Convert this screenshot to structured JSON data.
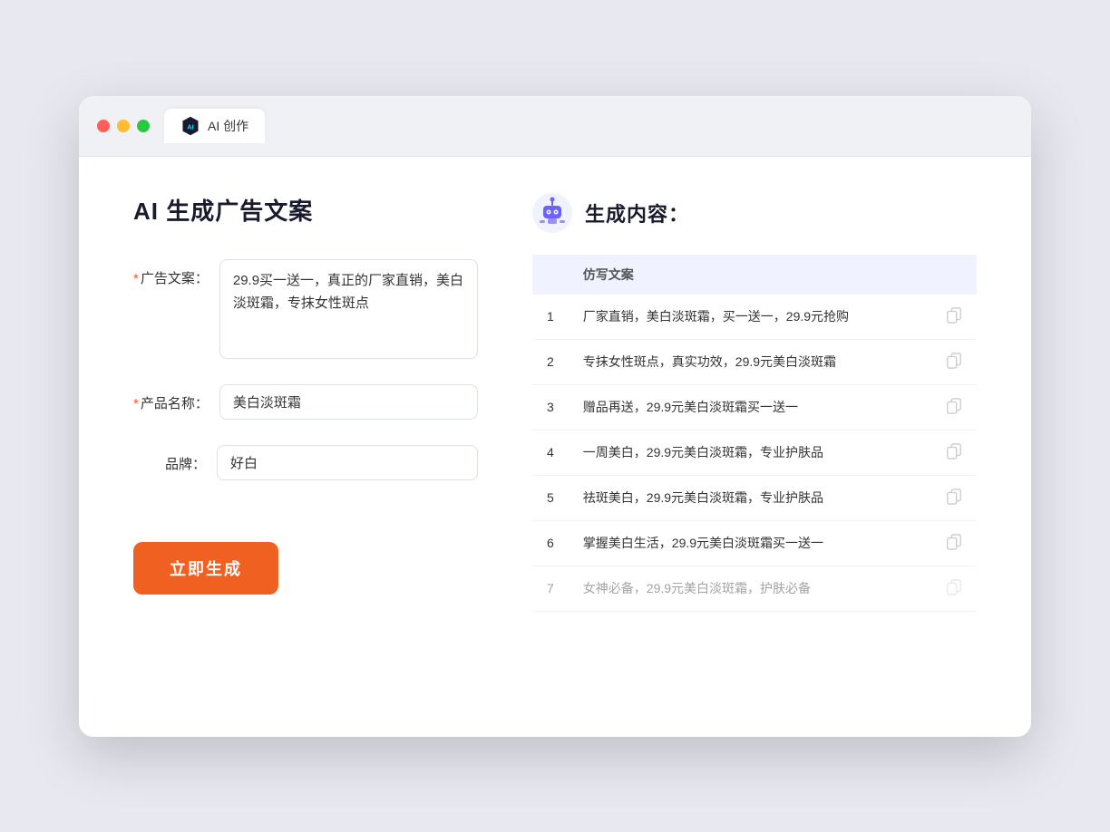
{
  "browser": {
    "tab_label": "AI 创作"
  },
  "page": {
    "title": "AI 生成广告文案",
    "result_title": "生成内容："
  },
  "form": {
    "ad_copy_label": "广告文案：",
    "ad_copy_placeholder": "",
    "ad_copy_value": "29.9买一送一，真正的厂家直销，美白淡斑霜，专抹女性斑点",
    "product_name_label": "产品名称：",
    "product_name_value": "美白淡斑霜",
    "brand_label": "品牌：",
    "brand_value": "好白",
    "required_star": "*",
    "generate_button": "立即生成"
  },
  "results": {
    "column_header": "仿写文案",
    "items": [
      {
        "num": "1",
        "text": "厂家直销，美白淡斑霜，买一送一，29.9元抢购"
      },
      {
        "num": "2",
        "text": "专抹女性斑点，真实功效，29.9元美白淡斑霜"
      },
      {
        "num": "3",
        "text": "赠品再送，29.9元美白淡斑霜买一送一"
      },
      {
        "num": "4",
        "text": "一周美白，29.9元美白淡斑霜，专业护肤品"
      },
      {
        "num": "5",
        "text": "祛斑美白，29.9元美白淡斑霜，专业护肤品"
      },
      {
        "num": "6",
        "text": "掌握美白生活，29.9元美白淡斑霜买一送一"
      },
      {
        "num": "7",
        "text": "女神必备，29.9元美白淡斑霜，护肤必备"
      }
    ]
  }
}
